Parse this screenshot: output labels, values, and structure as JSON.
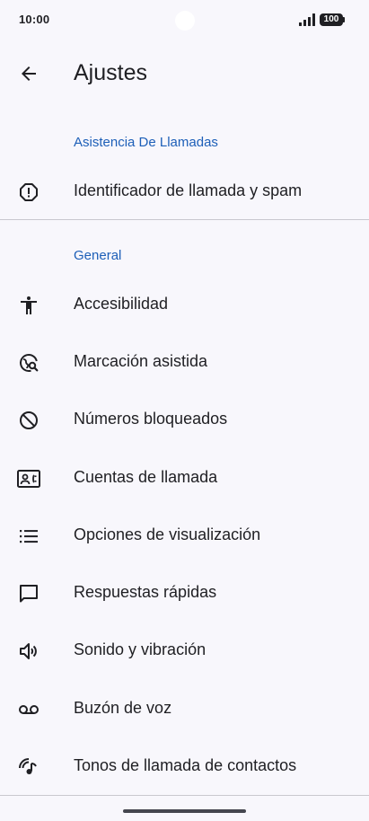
{
  "status_bar": {
    "time": "10:00",
    "battery": "100",
    "signal_icon": "signal-icon",
    "battery_icon": "battery-icon"
  },
  "app_bar": {
    "title": "Ajustes",
    "back_icon": "arrow-back-icon"
  },
  "sections": [
    {
      "header": "Asistencia De Llamadas",
      "items": [
        {
          "label": "Identificador de llamada y spam",
          "icon": "alert-octagon-icon"
        }
      ]
    },
    {
      "header": "General",
      "items": [
        {
          "label": "Accesibilidad",
          "icon": "accessibility-icon"
        },
        {
          "label": "Marcación asistida",
          "icon": "globe-search-icon"
        },
        {
          "label": "Números bloqueados",
          "icon": "block-icon"
        },
        {
          "label": "Cuentas de llamada",
          "icon": "contact-phone-icon"
        },
        {
          "label": "Opciones de visualización",
          "icon": "list-icon"
        },
        {
          "label": "Respuestas rápidas",
          "icon": "chat-bubble-icon"
        },
        {
          "label": "Sonido y vibración",
          "icon": "volume-icon"
        },
        {
          "label": "Buzón de voz",
          "icon": "voicemail-icon"
        },
        {
          "label": "Tonos de llamada de contactos",
          "icon": "ringtone-icon"
        }
      ]
    }
  ],
  "colors": {
    "background": "#f8f7fc",
    "accent": "#1d5fb8",
    "text": "#1f1f23",
    "divider": "#c9c8cf"
  }
}
